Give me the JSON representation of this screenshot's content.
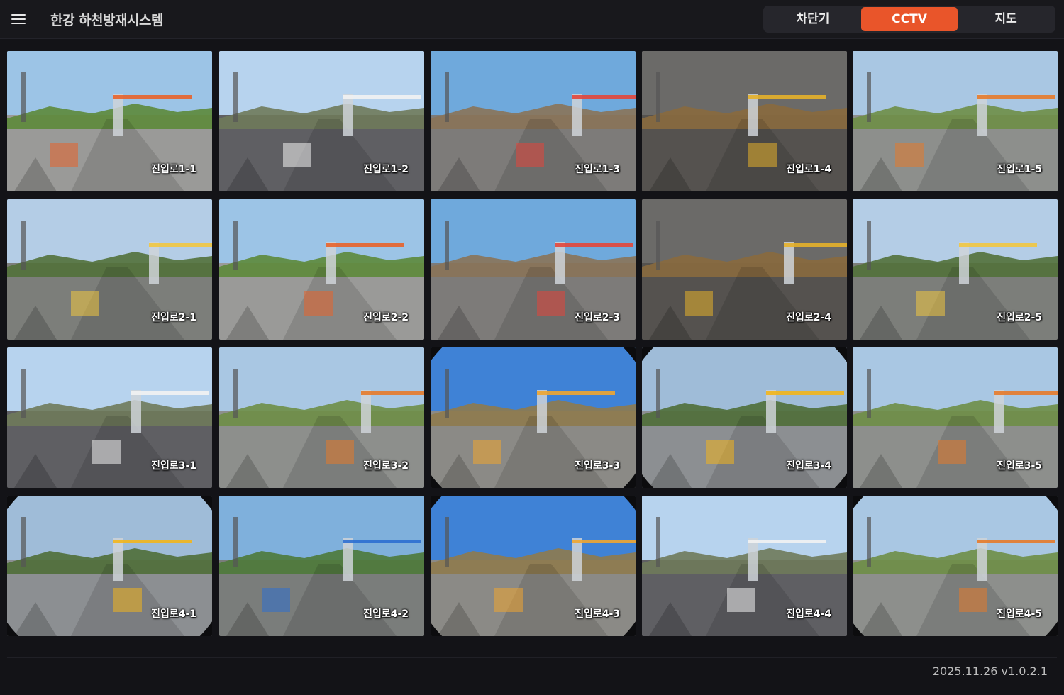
{
  "header": {
    "title": "한강 하천방재시스템",
    "tabs": [
      {
        "label": "차단기",
        "active": false
      },
      {
        "label": "CCTV",
        "active": true
      },
      {
        "label": "지도",
        "active": false
      }
    ],
    "accent_color": "#e9552a"
  },
  "cameras": [
    {
      "label": "진입로1-1",
      "scene": "road"
    },
    {
      "label": "진입로1-2",
      "scene": "building"
    },
    {
      "label": "진입로1-3",
      "scene": "gate"
    },
    {
      "label": "진입로1-4",
      "scene": "asphalt"
    },
    {
      "label": "진입로1-5",
      "scene": "park"
    },
    {
      "label": "진입로2-1",
      "scene": "river"
    },
    {
      "label": "진입로2-2",
      "scene": "road"
    },
    {
      "label": "진입로2-3",
      "scene": "gate"
    },
    {
      "label": "진입로2-4",
      "scene": "asphalt"
    },
    {
      "label": "진입로2-5",
      "scene": "river"
    },
    {
      "label": "진입로3-1",
      "scene": "building"
    },
    {
      "label": "진입로3-2",
      "scene": "park"
    },
    {
      "label": "진입로3-3",
      "scene": "village"
    },
    {
      "label": "진입로3-4",
      "scene": "plaza"
    },
    {
      "label": "진입로3-5",
      "scene": "park"
    },
    {
      "label": "진입로4-1",
      "scene": "plaza"
    },
    {
      "label": "진입로4-2",
      "scene": "bridge"
    },
    {
      "label": "진입로4-3",
      "scene": "village"
    },
    {
      "label": "진입로4-4",
      "scene": "building"
    },
    {
      "label": "진입로4-5",
      "scene": "park"
    }
  ],
  "footer": {
    "version": "2025.11.26  v1.0.2.1"
  }
}
